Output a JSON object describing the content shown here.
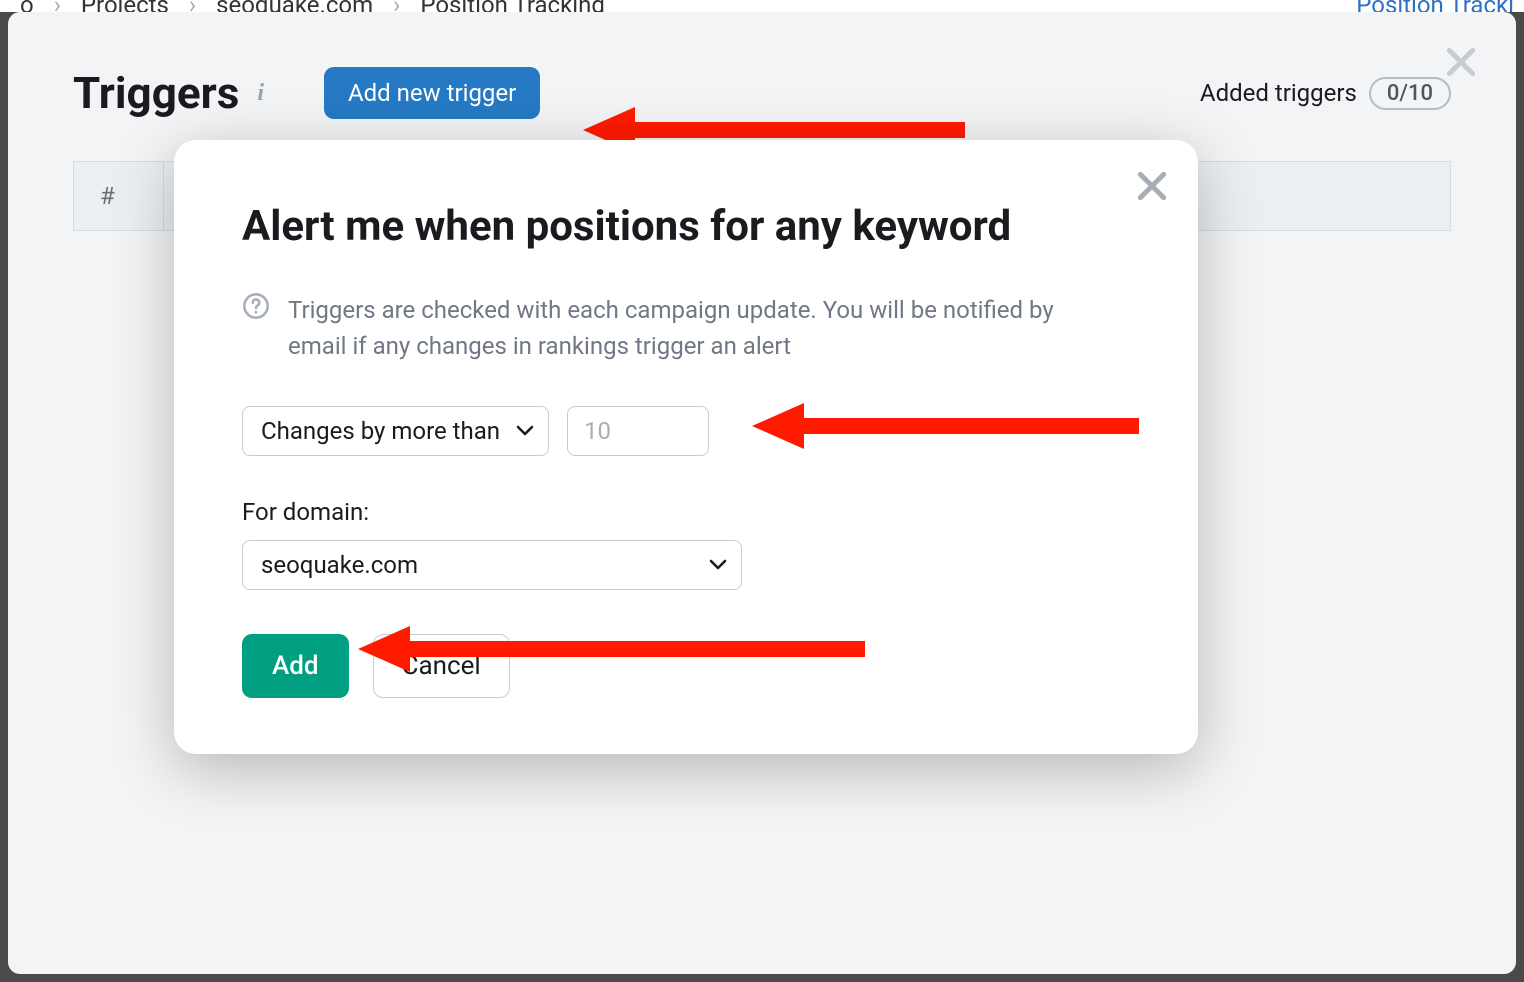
{
  "breadcrumb": {
    "item1": "o",
    "item2": "Projects",
    "item3": "seoquake.com",
    "item4": "Position Tracking",
    "right_link": "Position Tracki"
  },
  "panel": {
    "title": "Triggers",
    "add_button": "Add new trigger",
    "added_label": "Added triggers",
    "added_count": "0/10",
    "table": {
      "col_hash": "#"
    }
  },
  "modal": {
    "title": "Alert me when positions for any keyword",
    "help_text": "Triggers are checked with each campaign update. You will be notified by email if any changes in rankings trigger an alert",
    "condition_select": "Changes by more than",
    "value_placeholder": "10",
    "domain_label": "For domain:",
    "domain_value": "seoquake.com",
    "add_button": "Add",
    "cancel_button": "Cancel"
  }
}
